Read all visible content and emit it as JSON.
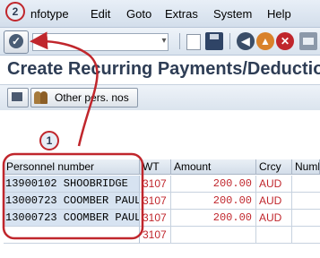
{
  "menu": {
    "items": [
      {
        "id": "infotype",
        "label": "nfotype"
      },
      {
        "id": "edit",
        "label": "Edit"
      },
      {
        "id": "goto",
        "label": "Goto"
      },
      {
        "id": "extras",
        "label": "Extras"
      },
      {
        "id": "system",
        "label": "System"
      },
      {
        "id": "help",
        "label": "Help"
      }
    ]
  },
  "page": {
    "title": "Create Recurring Payments/Deductions"
  },
  "app_toolbar": {
    "other_pers_label": "Other pers. nos"
  },
  "table": {
    "columns": [
      "Personnel number",
      "WT",
      "Amount",
      "Crcy",
      "Numb"
    ],
    "rows": [
      {
        "pers": "13900102 SHOOBRIDGE",
        "wt": "3107",
        "amount": "200.00",
        "crcy": "AUD"
      },
      {
        "pers": "13000723 COOMBER PAUL",
        "wt": "3107",
        "amount": "200.00",
        "crcy": "AUD"
      },
      {
        "pers": "13000723 COOMBER PAUL",
        "wt": "3107",
        "amount": "200.00",
        "crcy": "AUD"
      },
      {
        "pers": "",
        "wt": "3107",
        "amount": "",
        "crcy": ""
      }
    ]
  },
  "annotations": {
    "step1": "1",
    "step2": "2",
    "color": "#c0262c"
  }
}
